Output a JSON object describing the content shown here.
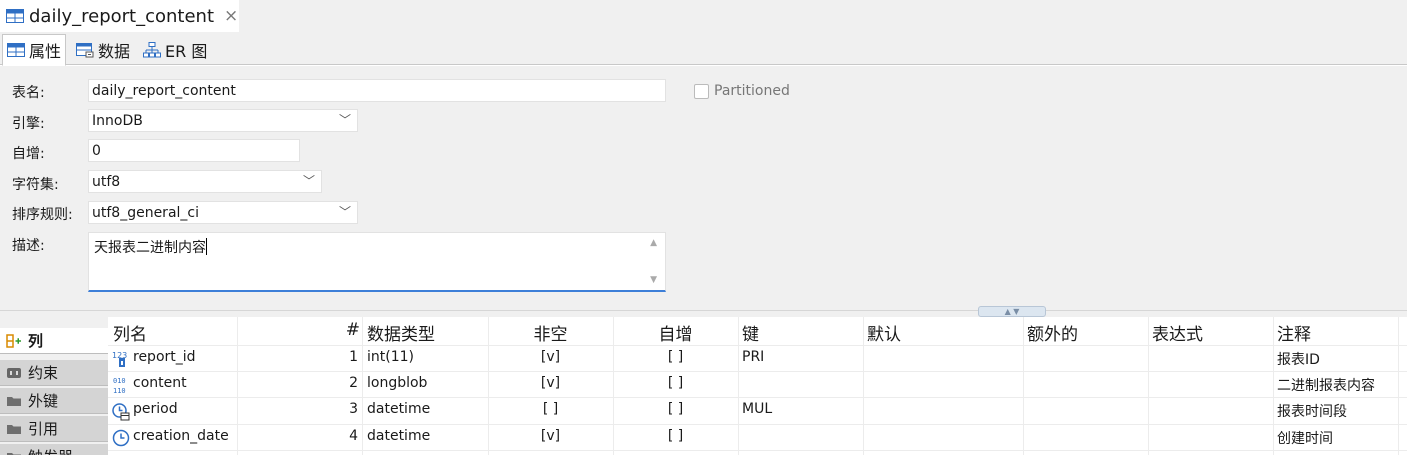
{
  "editor_tab": {
    "title": "daily_report_content",
    "close_glyph": "×",
    "icon": "table-icon"
  },
  "subtabs": [
    {
      "label": "属性",
      "icon": "table-properties-icon"
    },
    {
      "label": "数据",
      "icon": "table-data-icon"
    },
    {
      "label": "ER 图",
      "icon": "er-diagram-icon"
    }
  ],
  "form": {
    "table_name": {
      "label": "表名:",
      "value": "daily_report_content"
    },
    "engine": {
      "label": "引擎:",
      "value": "InnoDB"
    },
    "auto_increment": {
      "label": "自增:",
      "value": "0"
    },
    "charset": {
      "label": "字符集:",
      "value": "utf8"
    },
    "collation": {
      "label": "排序规则:",
      "value": "utf8_general_ci"
    },
    "description": {
      "label": "描述:",
      "value": "天报表二进制内容"
    },
    "partitioned": {
      "label": "Partitioned",
      "checked": false
    }
  },
  "side_tabs": [
    {
      "label": "列",
      "icon": "column-add-icon"
    },
    {
      "label": "约束",
      "icon": "constraint-icon"
    },
    {
      "label": "外键",
      "icon": "folder-icon"
    },
    {
      "label": "引用",
      "icon": "folder-icon"
    },
    {
      "label": "触发器",
      "icon": "folder-icon"
    }
  ],
  "grid": {
    "headers": {
      "name": "列名",
      "num": "#",
      "type": "数据类型",
      "notnull": "非空",
      "autoinc": "自增",
      "key": "键",
      "default": "默认",
      "extra": "额外的",
      "expr": "表达式",
      "comment": "注释"
    },
    "rows": [
      {
        "icon": "numeric-column-icon",
        "name": "report_id",
        "num": "1",
        "type": "int(11)",
        "notnull": "[v]",
        "autoinc": "[ ]",
        "key": "PRI",
        "comment": "报表ID"
      },
      {
        "icon": "binary-column-icon",
        "name": "content",
        "num": "2",
        "type": "longblob",
        "notnull": "[v]",
        "autoinc": "[ ]",
        "key": "",
        "comment": "二进制报表内容"
      },
      {
        "icon": "datetime-column-icon",
        "name": "period",
        "num": "3",
        "type": "datetime",
        "notnull": "[ ]",
        "autoinc": "[ ]",
        "key": "MUL",
        "comment": "报表时间段"
      },
      {
        "icon": "clock-icon",
        "name": "creation_date",
        "num": "4",
        "type": "datetime",
        "notnull": "[v]",
        "autoinc": "[ ]",
        "key": "",
        "comment": "创建时间"
      }
    ]
  },
  "colors": {
    "accent": "#3d7fd8",
    "panel_bg": "#f0f0f0",
    "icon_blue": "#2f6fc4",
    "folder_gray": "#6e6e6e"
  }
}
